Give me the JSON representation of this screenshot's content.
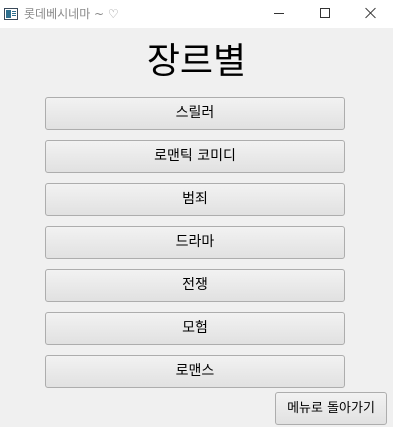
{
  "window": {
    "title": "롯데베시네마 ~ ♡",
    "app_icon": "app-window-icon",
    "controls": [
      "minimize-icon",
      "maximize-icon",
      "close-icon"
    ]
  },
  "heading": "장르별",
  "genres": [
    {
      "label": "스릴러"
    },
    {
      "label": "로맨틱 코미디"
    },
    {
      "label": "범죄"
    },
    {
      "label": "드라마"
    },
    {
      "label": "전쟁"
    },
    {
      "label": "모험"
    },
    {
      "label": "로맨스"
    }
  ],
  "back_button": "메뉴로 돌아가기",
  "colors": {
    "background": "#f0f0f0",
    "titlebar": "#ffffff",
    "button_border": "#adadad"
  }
}
